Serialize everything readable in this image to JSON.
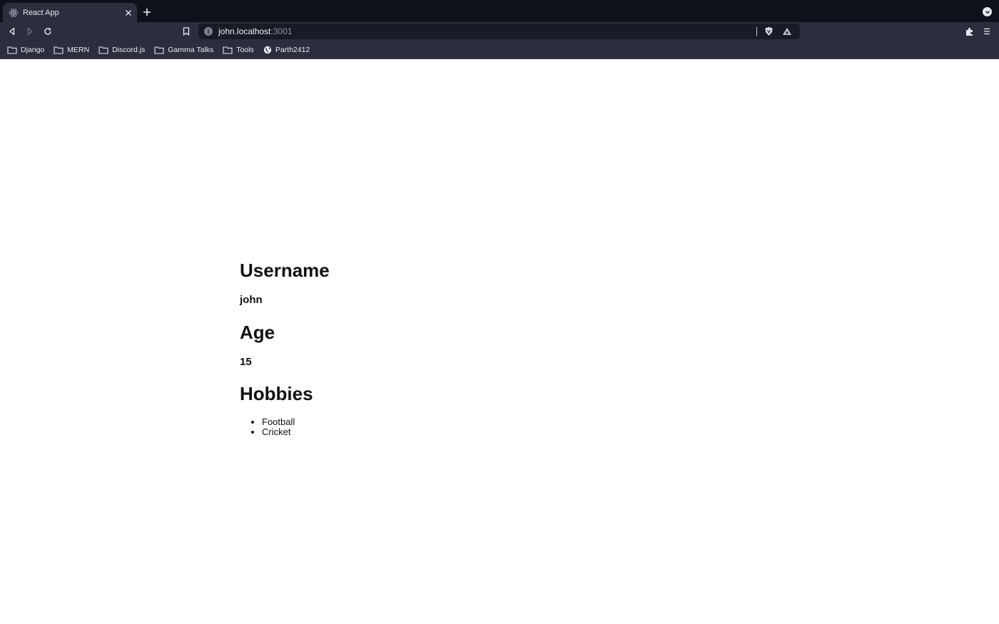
{
  "browser": {
    "tab": {
      "title": "React App"
    },
    "address": {
      "host": "john.localhost",
      "port": ":3001"
    },
    "bookmarks": [
      {
        "label": "Django",
        "icon": "folder-icon"
      },
      {
        "label": "MERN",
        "icon": "folder-icon"
      },
      {
        "label": "Discord.js",
        "icon": "folder-icon"
      },
      {
        "label": "Gamma Talks",
        "icon": "folder-icon"
      },
      {
        "label": "Tools",
        "icon": "folder-icon"
      },
      {
        "label": "Parth2412",
        "icon": "globe-icon"
      }
    ],
    "colors": {
      "tabstrip": "#0e101a",
      "toolbar": "#2a2e3d",
      "omnibox": "#181b26"
    }
  },
  "page": {
    "username": {
      "heading": "Username",
      "value": "john"
    },
    "age": {
      "heading": "Age",
      "value": "15"
    },
    "hobbies": {
      "heading": "Hobbies",
      "items": [
        "Football",
        "Cricket"
      ]
    }
  }
}
